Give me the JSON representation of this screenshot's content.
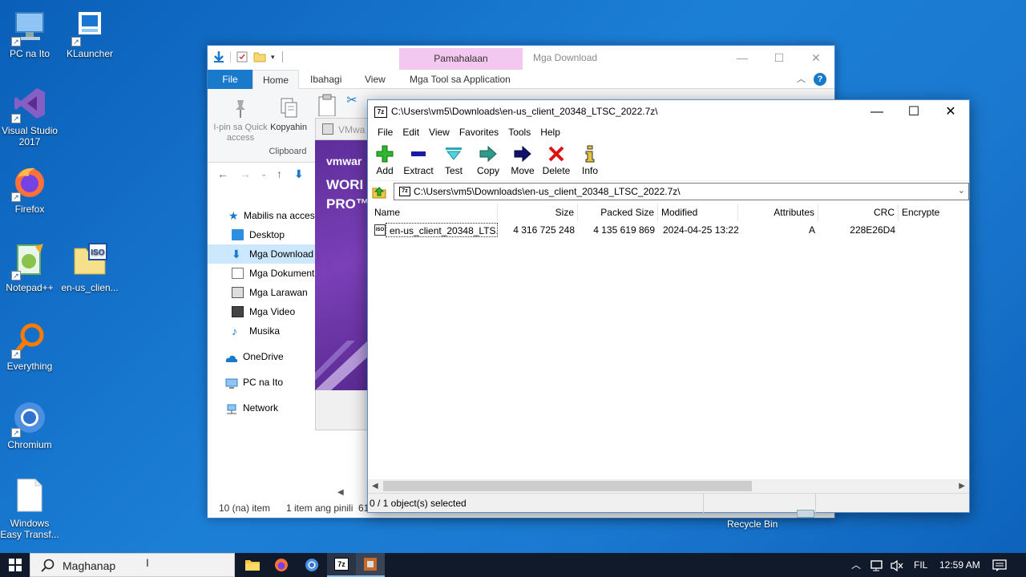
{
  "desktop": {
    "icons": [
      {
        "label": "PC na Ito",
        "icon": "computer-icon"
      },
      {
        "label": "KLauncher",
        "icon": "launcher-icon"
      },
      {
        "label": "Visual Studio 2017",
        "icon": "visual-studio-icon"
      },
      {
        "label": "Firefox",
        "icon": "firefox-icon"
      },
      {
        "label": "Notepad++",
        "icon": "notepadpp-icon"
      },
      {
        "label": "en-us_clien...",
        "icon": "iso-file-icon"
      },
      {
        "label": "Everything",
        "icon": "everything-search-icon"
      },
      {
        "label": "Chromium",
        "icon": "chromium-icon"
      },
      {
        "label": "Windows Easy Transf...",
        "icon": "document-icon"
      }
    ],
    "recycle_bin": "Recycle Bin"
  },
  "explorer": {
    "context_tab": "Pamahalaan",
    "title": "Mga Download",
    "tabs": [
      "File",
      "Home",
      "Ibahagi",
      "View",
      "Mga Tool sa Application"
    ],
    "ribbon": {
      "pin_label": "I-pin sa Quick access",
      "copy_label": "Kopyahin",
      "group_label": "Clipboard"
    },
    "sidebar": [
      {
        "label": "Mabilis na access",
        "icon": "star-icon",
        "level": 0
      },
      {
        "label": "Desktop",
        "icon": "desktop-folder-icon",
        "level": 1
      },
      {
        "label": "Mga Download",
        "icon": "download-folder-icon",
        "level": 1,
        "selected": true
      },
      {
        "label": "Mga Dokument",
        "icon": "documents-folder-icon",
        "level": 1
      },
      {
        "label": "Mga Larawan",
        "icon": "pictures-folder-icon",
        "level": 1
      },
      {
        "label": "Mga Video",
        "icon": "videos-folder-icon",
        "level": 1
      },
      {
        "label": "Musika",
        "icon": "music-icon",
        "level": 1
      },
      {
        "label": "OneDrive",
        "icon": "onedrive-icon",
        "level": 0
      },
      {
        "label": "PC na Ito",
        "icon": "computer-icon",
        "level": 0
      },
      {
        "label": "Network",
        "icon": "network-icon",
        "level": 0
      }
    ],
    "status": {
      "items": "10 (na) item",
      "selected": "1 item ang pinili",
      "size": "61"
    }
  },
  "vmware": {
    "title_fragment": "VMwa",
    "brand": "vmwar",
    "line1": "WORI",
    "line2": "PRO™"
  },
  "sevenzip": {
    "title": "C:\\Users\\vm5\\Downloads\\en-us_client_20348_LTSC_2022.7z\\",
    "app_icon": "7z",
    "menu": [
      "File",
      "Edit",
      "View",
      "Favorites",
      "Tools",
      "Help"
    ],
    "toolbar": [
      {
        "label": "Add",
        "icon": "add-icon"
      },
      {
        "label": "Extract",
        "icon": "extract-icon"
      },
      {
        "label": "Test",
        "icon": "test-icon"
      },
      {
        "label": "Copy",
        "icon": "copy-icon"
      },
      {
        "label": "Move",
        "icon": "move-icon"
      },
      {
        "label": "Delete",
        "icon": "delete-icon"
      },
      {
        "label": "Info",
        "icon": "info-icon"
      }
    ],
    "address": "C:\\Users\\vm5\\Downloads\\en-us_client_20348_LTSC_2022.7z\\",
    "columns": [
      "Name",
      "Size",
      "Packed Size",
      "Modified",
      "Attributes",
      "CRC",
      "Encrypte"
    ],
    "rows": [
      {
        "name": "en-us_client_20348_LTS...",
        "size": "4 316 725 248",
        "packed": "4 135 619 869",
        "modified": "2024-04-25 13:22",
        "attributes": "A",
        "crc": "228E26D4",
        "encrypted": ""
      }
    ],
    "status": "0 / 1 object(s) selected"
  },
  "taskbar": {
    "search_placeholder": "Maghanap",
    "language": "FIL",
    "time": "12:59 AM"
  },
  "colors": {
    "accent": "#1979ca",
    "context_tab": "#f3c7ef",
    "selection": "#cce8ff",
    "taskbar": "#101a2a"
  }
}
